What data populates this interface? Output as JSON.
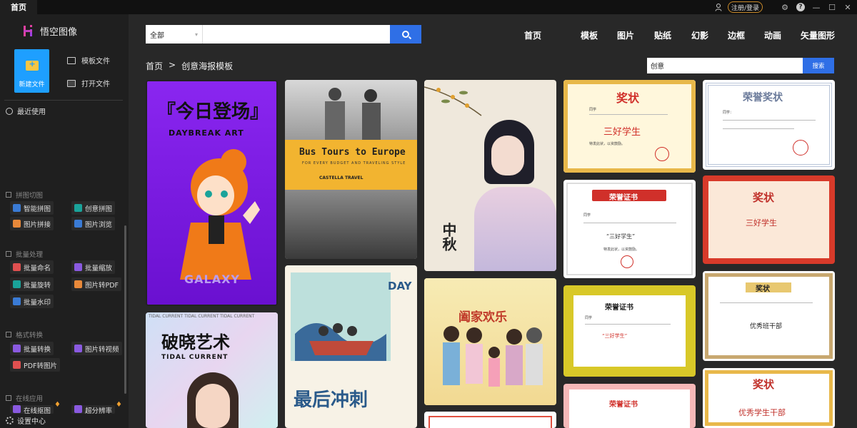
{
  "titlebar": {
    "tab_home": "首页",
    "login": "注册/登录"
  },
  "sidebar": {
    "logo_text": "悟空图像",
    "new_file": "新建文件",
    "template_file": "模板文件",
    "open_file": "打开文件",
    "recent": "最近使用",
    "sections": [
      {
        "title": "拼图切图",
        "tools": [
          "智能拼图",
          "创意拼图",
          "图片拼接",
          "图片浏览"
        ]
      },
      {
        "title": "批量处理",
        "tools": [
          "批量命名",
          "批量缩放",
          "批量旋转",
          "图片转PDF",
          "批量水印"
        ]
      },
      {
        "title": "格式转换",
        "tools": [
          "批量转换",
          "图片转视频",
          "PDF转图片"
        ]
      },
      {
        "title": "在线应用",
        "tools": [
          "在线抠图",
          "超分辨率"
        ]
      }
    ],
    "settings": "设置中心"
  },
  "search": {
    "select_value": "全部",
    "placeholder": ""
  },
  "topnav": [
    "首页",
    "模板",
    "图片",
    "贴纸",
    "幻影",
    "边框",
    "动画",
    "矢量图形"
  ],
  "breadcrumb": {
    "home": "首页",
    "sep": ">",
    "current": "创意海报模板"
  },
  "search2": {
    "value": "创意",
    "button": "搜索"
  },
  "cards": {
    "c1": {
      "title": "『今日登场』",
      "sub": "DAYBREAK ART",
      "bottom": "GALAXY"
    },
    "c2": {
      "title": "破晓艺术",
      "sub": "TIDAL CURRENT",
      "band": "TIDAL CURRENT TIDAL CURRENT TIDAL CURRENT"
    },
    "c3": {
      "title": "Bus Tours to Europe",
      "sub": "FOR EVERY BUDGET AND TRAVELING STYLE",
      "brand": "CASTELLA TRAVEL"
    },
    "c4": {
      "title": "最后冲刺",
      "side": "DAY"
    },
    "c5": {
      "title": "中秋"
    },
    "c6": {
      "title": "阖家欢乐"
    },
    "c7": {
      "title": "奖状",
      "name_line": "同学",
      "honor": "三好学生",
      "foot": "特发此状，以资鼓励。"
    },
    "c8": {
      "title": "荣誉证书",
      "name_line": "同学",
      "honor": "“三好学生”",
      "foot": "特发此状，以资鼓励。"
    },
    "c9": {
      "title": "荣誉证书",
      "name_line": "同学",
      "honor": "“三好学生”"
    },
    "c10": {
      "title": "荣誉证书"
    },
    "c11": {
      "title": "荣誉奖状",
      "name_line": "同学："
    },
    "c12": {
      "title": "奖状",
      "honor": "三好学生"
    },
    "c13": {
      "title": "奖状",
      "honor": "优秀班干部"
    },
    "c14": {
      "title": "奖状",
      "honor": "优秀学生干部"
    }
  },
  "colors": {
    "accent": "#2f6fe6",
    "new_file_bg": "#1e9fff",
    "sidebar_bg": "#1f1f1f",
    "main_bg": "#282828"
  }
}
